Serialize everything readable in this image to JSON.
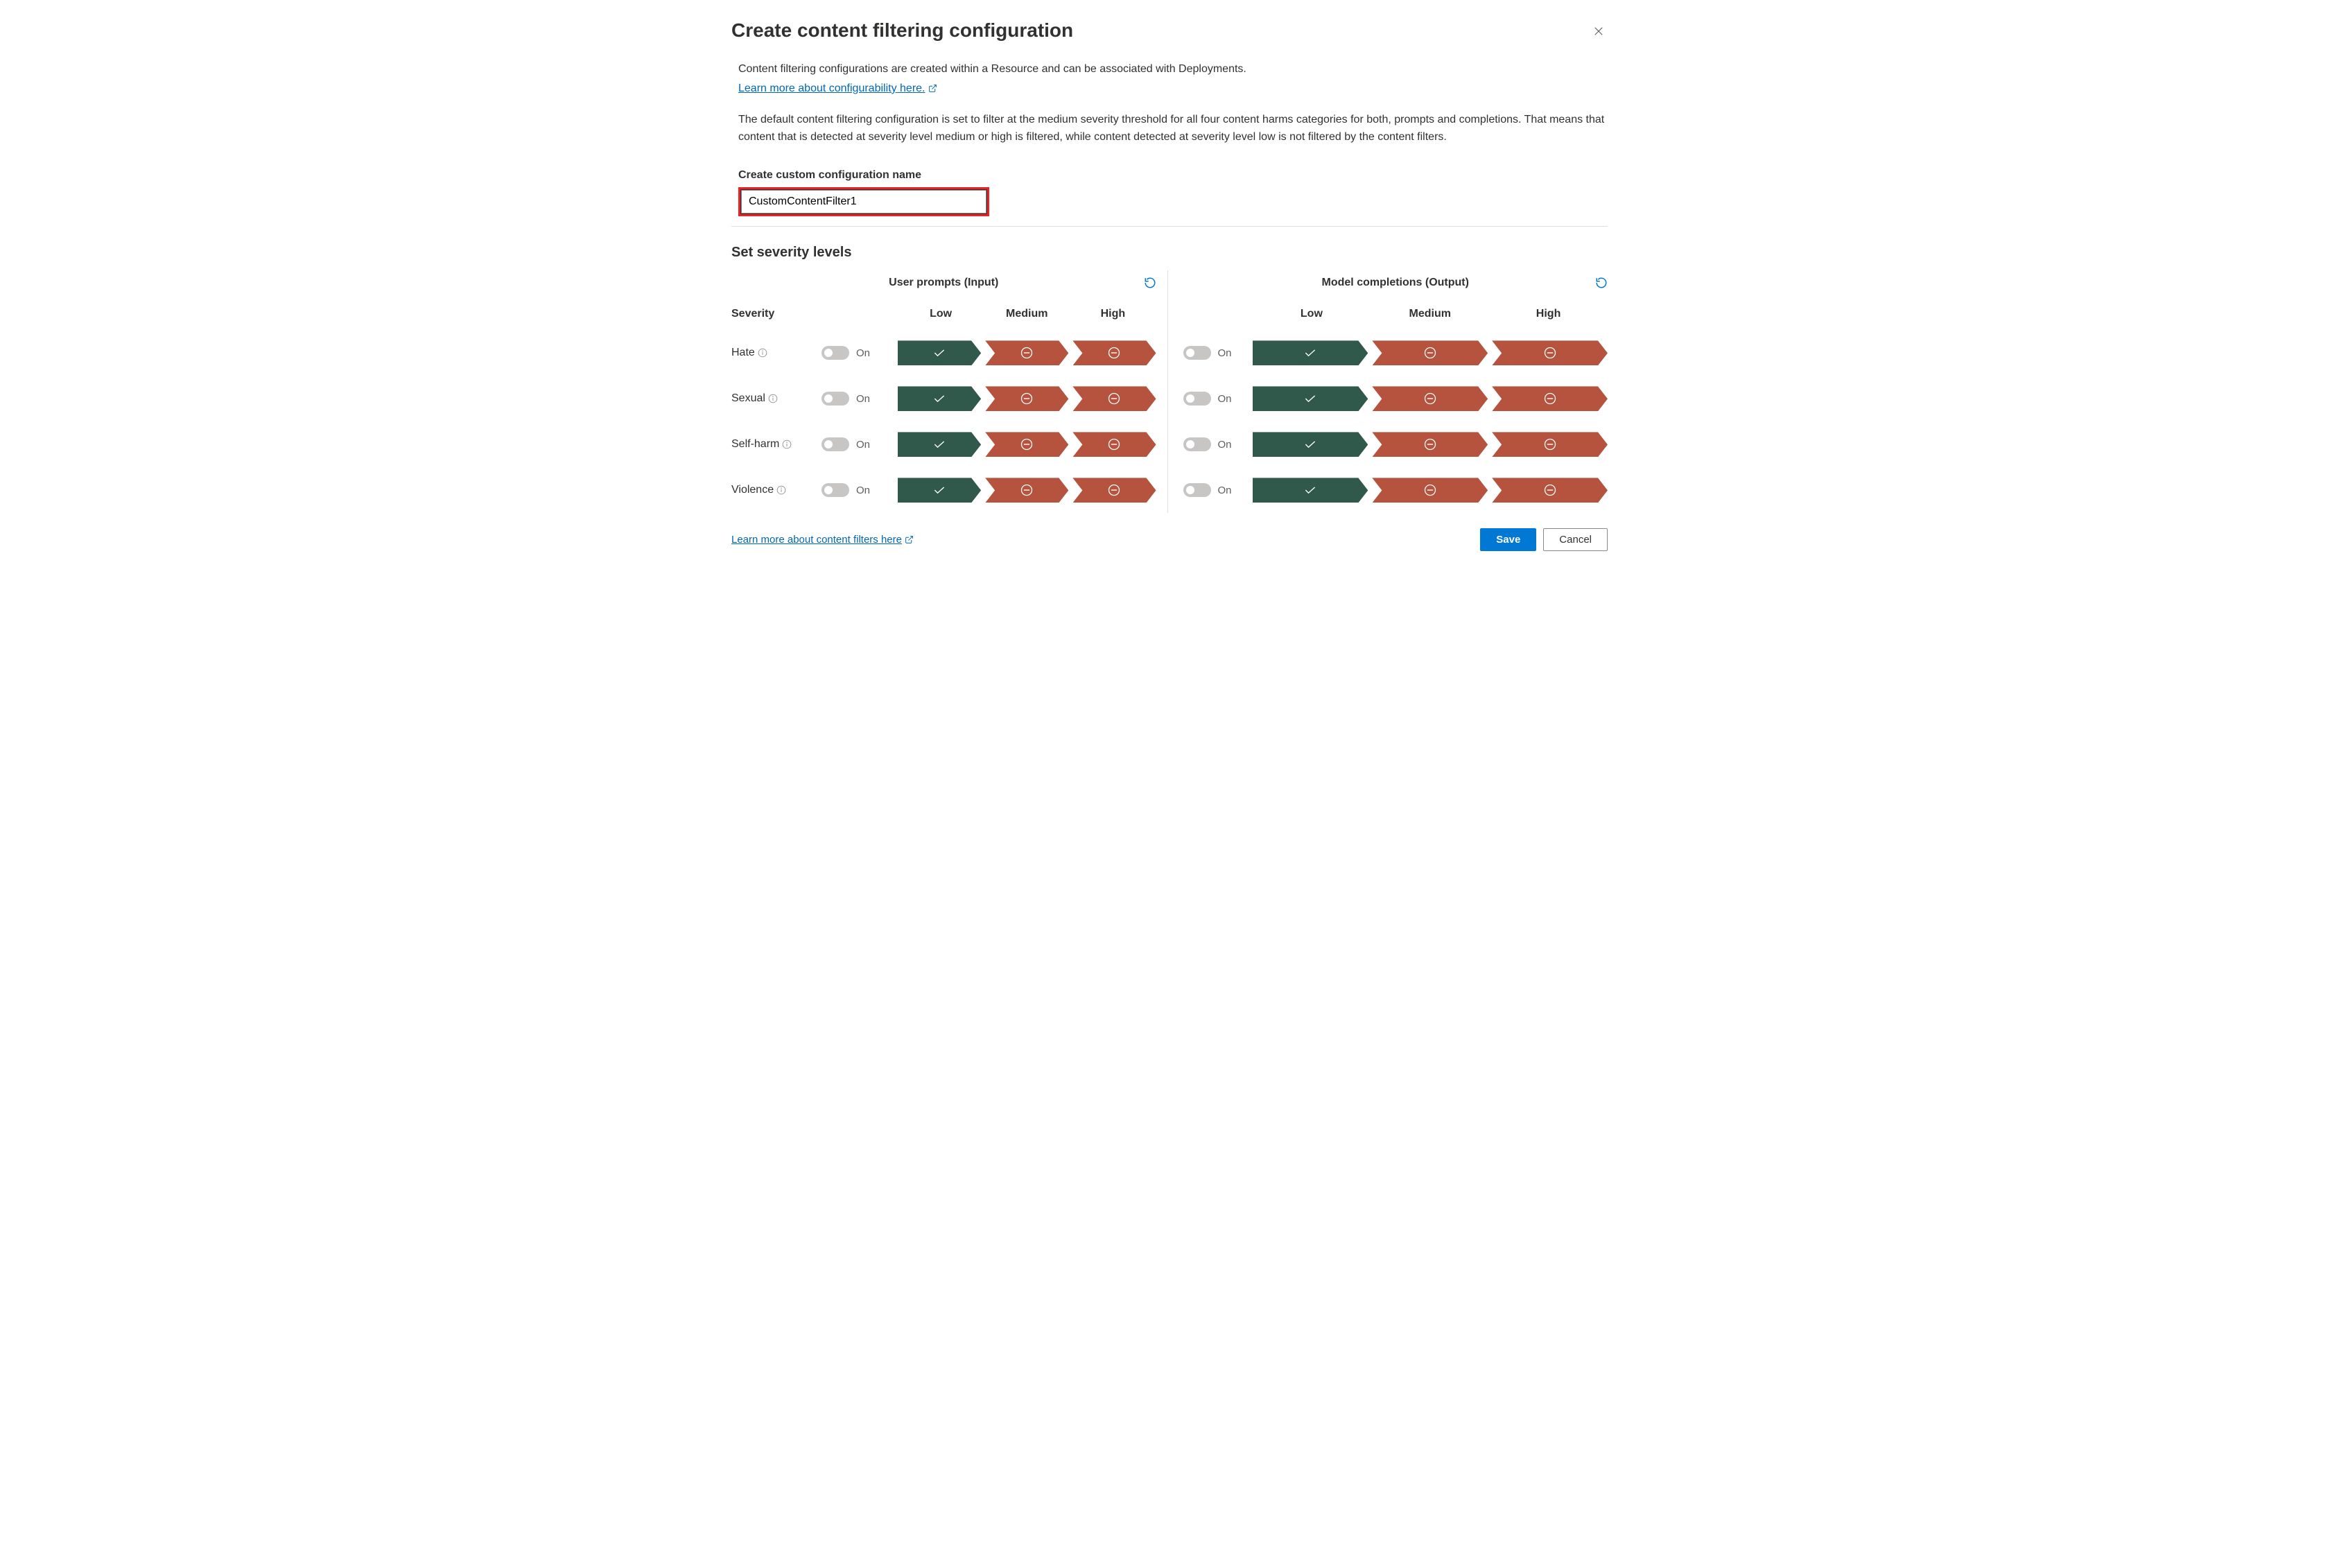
{
  "dialog": {
    "title": "Create content filtering configuration",
    "close_aria": "Close"
  },
  "intro": {
    "line1": "Content filtering configurations are created within a Resource and can be associated with Deployments.",
    "learn_more_config": "Learn more about configurability here.",
    "line2": "The default content filtering configuration is set to filter at the medium severity threshold for all four content harms categories for both, prompts and completions. That means that content that is detected at severity level medium or high is filtered, while content detected at severity level low is not filtered by the content filters."
  },
  "form": {
    "name_label": "Create custom configuration name",
    "name_value": "CustomContentFilter1"
  },
  "severity": {
    "title": "Set severity levels",
    "severity_label": "Severity",
    "levels": {
      "low": "Low",
      "medium": "Medium",
      "high": "High"
    },
    "toggle_label": "On",
    "panels": [
      {
        "key": "input",
        "title": "User prompts (Input)"
      },
      {
        "key": "output",
        "title": "Model completions (Output)"
      }
    ],
    "categories": [
      {
        "key": "hate",
        "label": "Hate"
      },
      {
        "key": "sexual",
        "label": "Sexual"
      },
      {
        "key": "selfharm",
        "label": "Self-harm"
      },
      {
        "key": "violence",
        "label": "Violence"
      }
    ],
    "state": {
      "input": {
        "hate": "low",
        "sexual": "low",
        "selfharm": "low",
        "violence": "low"
      },
      "output": {
        "hate": "low",
        "sexual": "low",
        "selfharm": "low",
        "violence": "low"
      }
    }
  },
  "footer": {
    "learn_more_filters": "Learn more about content filters here",
    "save": "Save",
    "cancel": "Cancel"
  }
}
